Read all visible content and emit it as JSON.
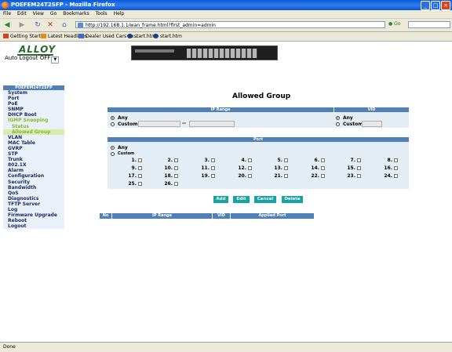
{
  "window": {
    "title": "POEFEM24T2SFP - Mozilla Firefox"
  },
  "menu": [
    "File",
    "Edit",
    "View",
    "Go",
    "Bookmarks",
    "Tools",
    "Help"
  ],
  "nav": {
    "url": "http://192.168.1.1/wan_frame.html?first_admin=admin",
    "go_label": "Go"
  },
  "bookmarks": [
    {
      "label": "Getting Started",
      "color": "#d8401e"
    },
    {
      "label": "Latest Headlines",
      "color": "#e88a1a"
    },
    {
      "label": "Dealer Used Cars Ev...",
      "color": "#3a6ec8"
    },
    {
      "label": "start.htm",
      "color": "#1a3a8a"
    },
    {
      "label": "start.htm",
      "color": "#1a3a8a"
    }
  ],
  "header": {
    "logo": "ALLOY",
    "auto_logout_label": "Auto Logout",
    "auto_logout_value": "OFF"
  },
  "sidebar": {
    "title": "POEFEM24T2SFP",
    "items": [
      {
        "label": "System",
        "style": "item"
      },
      {
        "label": "Port",
        "style": "item"
      },
      {
        "label": "PoE",
        "style": "item"
      },
      {
        "label": "SNMP",
        "style": "item"
      },
      {
        "label": "DHCP Boot",
        "style": "item"
      },
      {
        "label": "IGMP Snooping",
        "style": "item green"
      },
      {
        "label": "Status",
        "style": "item sub"
      },
      {
        "label": "Allowed Group",
        "style": "item sub sel"
      },
      {
        "label": "VLAN",
        "style": "item"
      },
      {
        "label": "MAC Table",
        "style": "item"
      },
      {
        "label": "GVRP",
        "style": "item"
      },
      {
        "label": "STP",
        "style": "item"
      },
      {
        "label": "Trunk",
        "style": "item"
      },
      {
        "label": "802.1X",
        "style": "item"
      },
      {
        "label": "Alarm",
        "style": "item"
      },
      {
        "label": "Configuration",
        "style": "item"
      },
      {
        "label": "Security",
        "style": "item"
      },
      {
        "label": "Bandwidth",
        "style": "item"
      },
      {
        "label": "QoS",
        "style": "item"
      },
      {
        "label": "Diagnostics",
        "style": "item"
      },
      {
        "label": "TFTP Server",
        "style": "item"
      },
      {
        "label": "Log",
        "style": "item"
      },
      {
        "label": "Firmware Upgrade",
        "style": "item"
      },
      {
        "label": "Reboot",
        "style": "item"
      },
      {
        "label": "Logout",
        "style": "item"
      }
    ]
  },
  "page_title": "Allowed Group",
  "ip_range": {
    "header": "IP Range",
    "any_label": "Any",
    "custom_label": "Custom",
    "separator": "--",
    "selected": "any"
  },
  "vid": {
    "header": "VID",
    "any_label": "Any",
    "custom_label": "Custom",
    "selected": "any"
  },
  "port": {
    "header": "Port",
    "any_label": "Any",
    "custom_label": "Custom",
    "selected": "any",
    "numbers": [
      "1.",
      "2.",
      "3.",
      "4.",
      "5.",
      "6.",
      "7.",
      "8.",
      "9.",
      "10.",
      "11.",
      "12.",
      "13.",
      "14.",
      "15.",
      "16.",
      "17.",
      "18.",
      "19.",
      "20.",
      "21.",
      "22.",
      "23.",
      "24.",
      "25.",
      "26."
    ]
  },
  "buttons": {
    "add": "Add",
    "edit": "Edit",
    "cancel": "Cancel",
    "delete": "Delete"
  },
  "rules_table": {
    "columns": [
      "No",
      "IP Range",
      "VID",
      "Applied Port"
    ]
  },
  "status_bar": {
    "text": "Done"
  }
}
